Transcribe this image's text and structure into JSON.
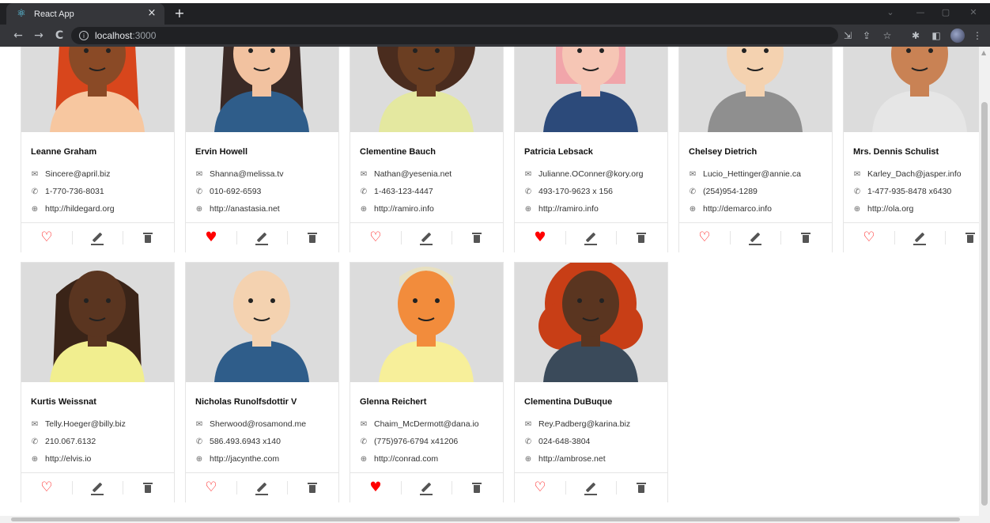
{
  "browser": {
    "tab_title": "React App",
    "tab_close": "×",
    "new_tab": "+",
    "url_host": "localhost",
    "url_port": ":3000",
    "nav": {
      "back": "←",
      "forward": "→",
      "reload": "C"
    },
    "icons": [
      "install-icon",
      "share-icon",
      "star-icon",
      "extensions-icon",
      "sidepanel-icon",
      "profile-avatar",
      "menu-icon"
    ]
  },
  "colors": {
    "heart": "#ff0000",
    "icon": "#555555",
    "card_border": "#e5e5e5",
    "avatar_bg": "#dcdcdc"
  },
  "users": [
    {
      "name": "Leanne Graham",
      "email": "Sincere@april.biz",
      "phone": "1-770-736-8031",
      "website": "http://hildegard.org",
      "liked": false
    },
    {
      "name": "Ervin Howell",
      "email": "Shanna@melissa.tv",
      "phone": "010-692-6593",
      "website": "http://anastasia.net",
      "liked": true
    },
    {
      "name": "Clementine Bauch",
      "email": "Nathan@yesenia.net",
      "phone": "1-463-123-4447",
      "website": "http://ramiro.info",
      "liked": false
    },
    {
      "name": "Patricia Lebsack",
      "email": "Julianne.OConner@kory.org",
      "phone": "493-170-9623 x 156",
      "website": "http://ramiro.info",
      "liked": true
    },
    {
      "name": "Chelsey Dietrich",
      "email": "Lucio_Hettinger@annie.ca",
      "phone": "(254)954-1289",
      "website": "http://demarco.info",
      "liked": false
    },
    {
      "name": "Mrs. Dennis Schulist",
      "email": "Karley_Dach@jasper.info",
      "phone": "1-477-935-8478 x6430",
      "website": "http://ola.org",
      "liked": false
    },
    {
      "name": "Kurtis Weissnat",
      "email": "Telly.Hoeger@billy.biz",
      "phone": "210.067.6132",
      "website": "http://elvis.io",
      "liked": false
    },
    {
      "name": "Nicholas Runolfsdottir V",
      "email": "Sherwood@rosamond.me",
      "phone": "586.493.6943 x140",
      "website": "http://jacynthe.com",
      "liked": false
    },
    {
      "name": "Glenna Reichert",
      "email": "Chaim_McDermott@dana.io",
      "phone": "(775)976-6794 x41206",
      "website": "http://conrad.com",
      "liked": true
    },
    {
      "name": "Clementina DuBuque",
      "email": "Rey.Padberg@karina.biz",
      "phone": "024-648-3804",
      "website": "http://ambrose.net",
      "liked": false
    }
  ]
}
